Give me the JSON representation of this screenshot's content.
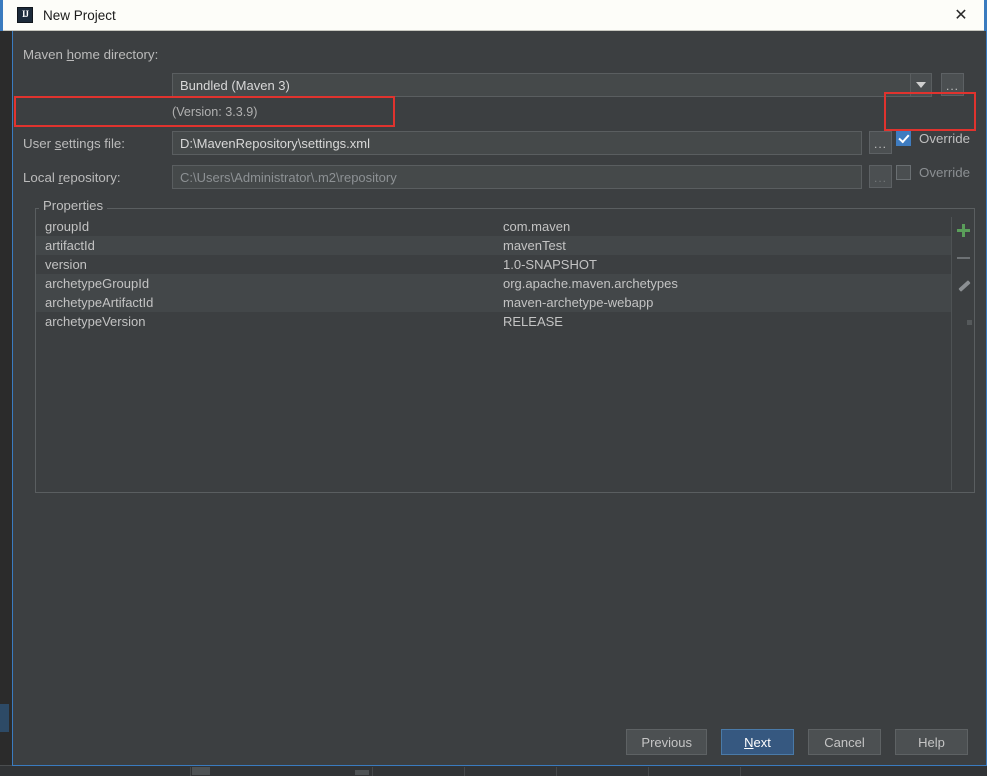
{
  "window": {
    "title": "New Project",
    "app_icon": "intellij-idea-icon",
    "close_icon": "✕"
  },
  "form": {
    "maven_home": {
      "label_prefix": "Maven ",
      "label_mnemonic": "h",
      "label_suffix": "ome directory:",
      "value": "Bundled (Maven 3)",
      "browse_label": "...",
      "version_note": "(Version: 3.3.9)"
    },
    "user_settings": {
      "label_prefix": "User ",
      "label_mnemonic": "s",
      "label_suffix": "ettings file:",
      "value": "D:\\MavenRepository\\settings.xml",
      "browse_label": "...",
      "override_label": "Override",
      "override_checked": true
    },
    "local_repository": {
      "label_prefix": "Local ",
      "label_mnemonic": "r",
      "label_suffix": "epository:",
      "value": "C:\\Users\\Administrator\\.m2\\repository",
      "browse_label": "...",
      "override_label": "Override",
      "override_checked": false
    }
  },
  "properties": {
    "group_title": "Properties",
    "rows": [
      {
        "key": "groupId",
        "value": "com.maven"
      },
      {
        "key": "artifactId",
        "value": "mavenTest"
      },
      {
        "key": "version",
        "value": "1.0-SNAPSHOT"
      },
      {
        "key": "archetypeGroupId",
        "value": "org.apache.maven.archetypes"
      },
      {
        "key": "archetypeArtifactId",
        "value": "maven-archetype-webapp"
      },
      {
        "key": "archetypeVersion",
        "value": "RELEASE"
      }
    ],
    "tools": {
      "add": "add-icon",
      "remove": "remove-icon",
      "edit": "edit-pencil-icon"
    }
  },
  "footer": {
    "previous": "Previous",
    "next_prefix": "",
    "next_mnemonic": "N",
    "next_suffix": "ext",
    "cancel": "Cancel",
    "help": "Help"
  },
  "colors": {
    "dialog_bg": "#3c3f41",
    "accent_border": "#3a7bbf",
    "default_button": "#365880",
    "checkbox_checked": "#3f7cc0",
    "annotation_red": "#e0332e",
    "add_icon_green": "#5a9e5a"
  }
}
